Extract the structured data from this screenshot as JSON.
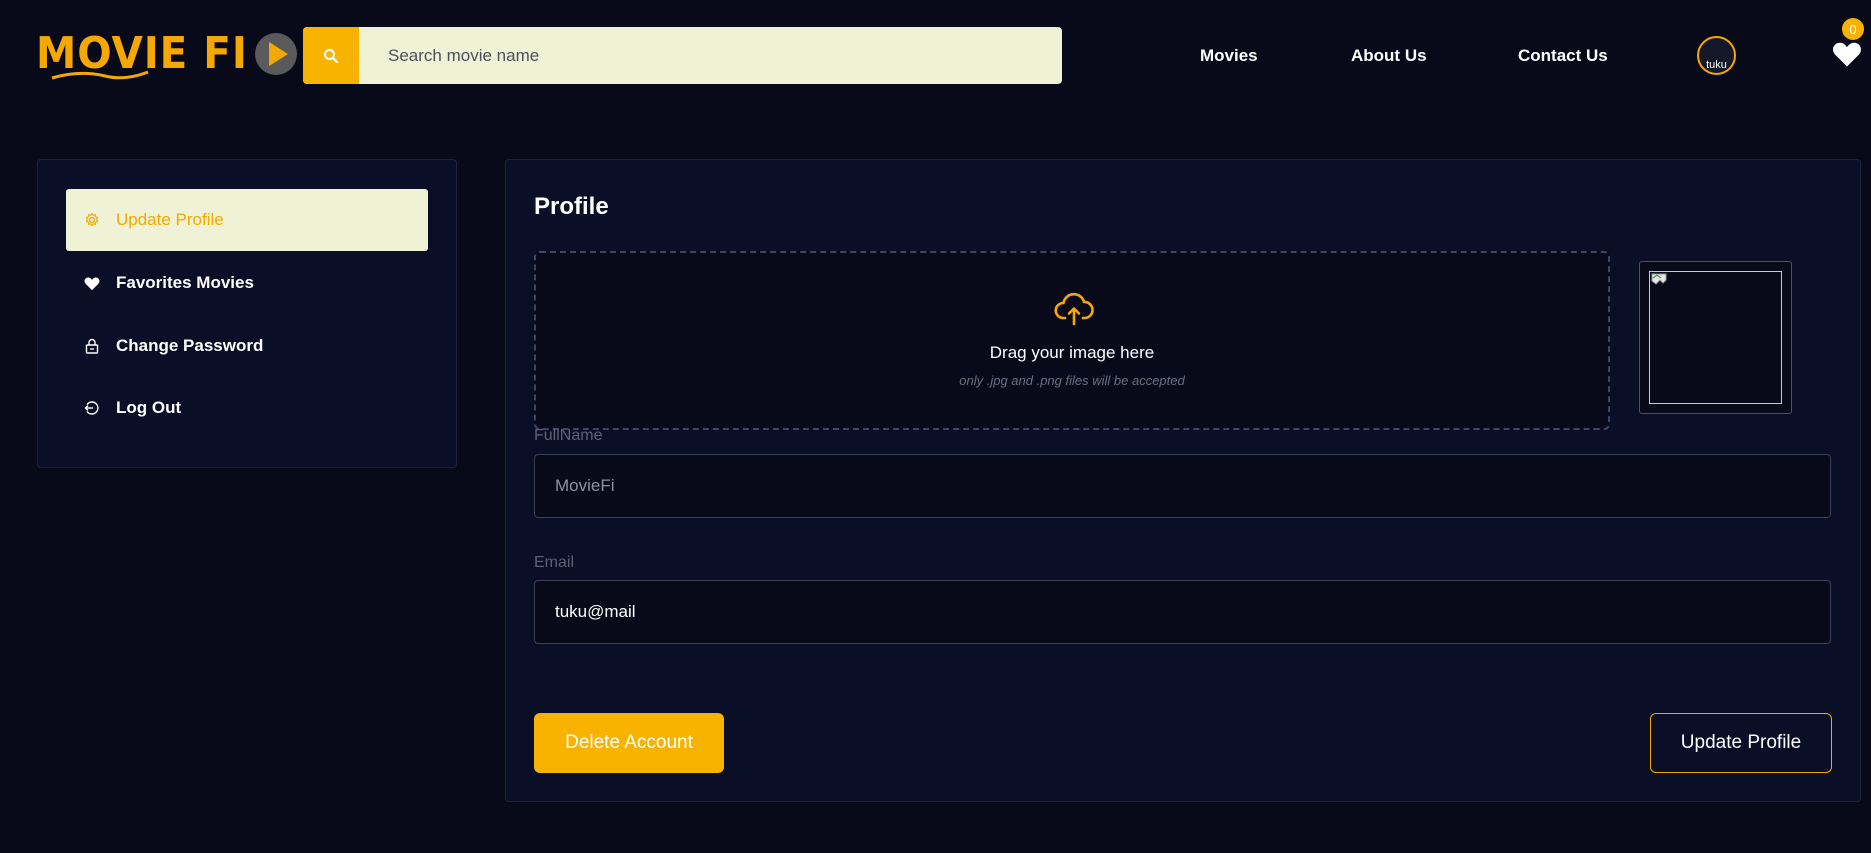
{
  "header": {
    "logo_text": "MOVIE FI",
    "search": {
      "placeholder": "Search movie name",
      "icon": "search-icon"
    },
    "nav": [
      {
        "label": "Movies"
      },
      {
        "label": "About Us"
      },
      {
        "label": "Contact Us"
      }
    ],
    "avatar_alt": "tuku",
    "favorites_count": "0",
    "favorites_icon": "heart-icon"
  },
  "sidebar": {
    "items": [
      {
        "label": "Update Profile",
        "icon": "gear-icon",
        "active": true
      },
      {
        "label": "Favorites Movies",
        "icon": "heart-icon",
        "active": false
      },
      {
        "label": "Change Password",
        "icon": "lock-icon",
        "active": false
      },
      {
        "label": "Log Out",
        "icon": "logout-icon",
        "active": false
      }
    ]
  },
  "profile": {
    "title": "Profile",
    "dropzone": {
      "icon": "cloud-upload-icon",
      "text": "Drag your image here",
      "subtext": "only .jpg and .png files will be accepted"
    },
    "fullname": {
      "label": "FullName",
      "value": "MovieFi"
    },
    "email": {
      "label": "Email",
      "value": "tuku@mail"
    },
    "delete_button": "Delete Account",
    "update_button": "Update Profile"
  },
  "colors": {
    "accent": "#f8b300",
    "background": "#080a1a",
    "panel": "#0b0e27",
    "active_item_bg": "#eff2d4"
  }
}
